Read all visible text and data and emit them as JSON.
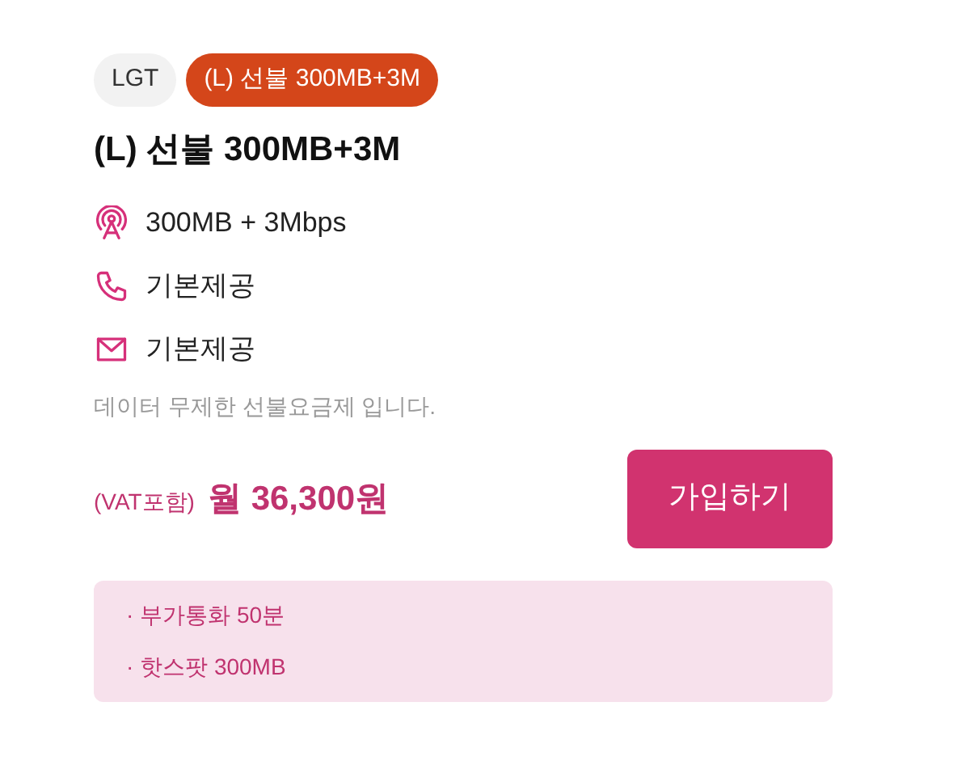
{
  "tags": [
    {
      "kind": "carrier",
      "label": "LGT"
    },
    {
      "kind": "plan",
      "label": "(L) 선불 300MB+3M"
    }
  ],
  "title": "(L) 선불 300MB+3M",
  "features": [
    {
      "kind": "data",
      "text": "300MB + 3Mbps"
    },
    {
      "kind": "voice",
      "text": "기본제공"
    },
    {
      "kind": "sms",
      "text": "기본제공"
    }
  ],
  "description": "데이터 무제한 선불요금제 입니다.",
  "price": {
    "note": "(VAT포함)",
    "amount": "월 36,300원"
  },
  "signup_button": "가입하기",
  "benefits": [
    "· 부가통화 50분",
    "· 핫스팟 300MB"
  ]
}
